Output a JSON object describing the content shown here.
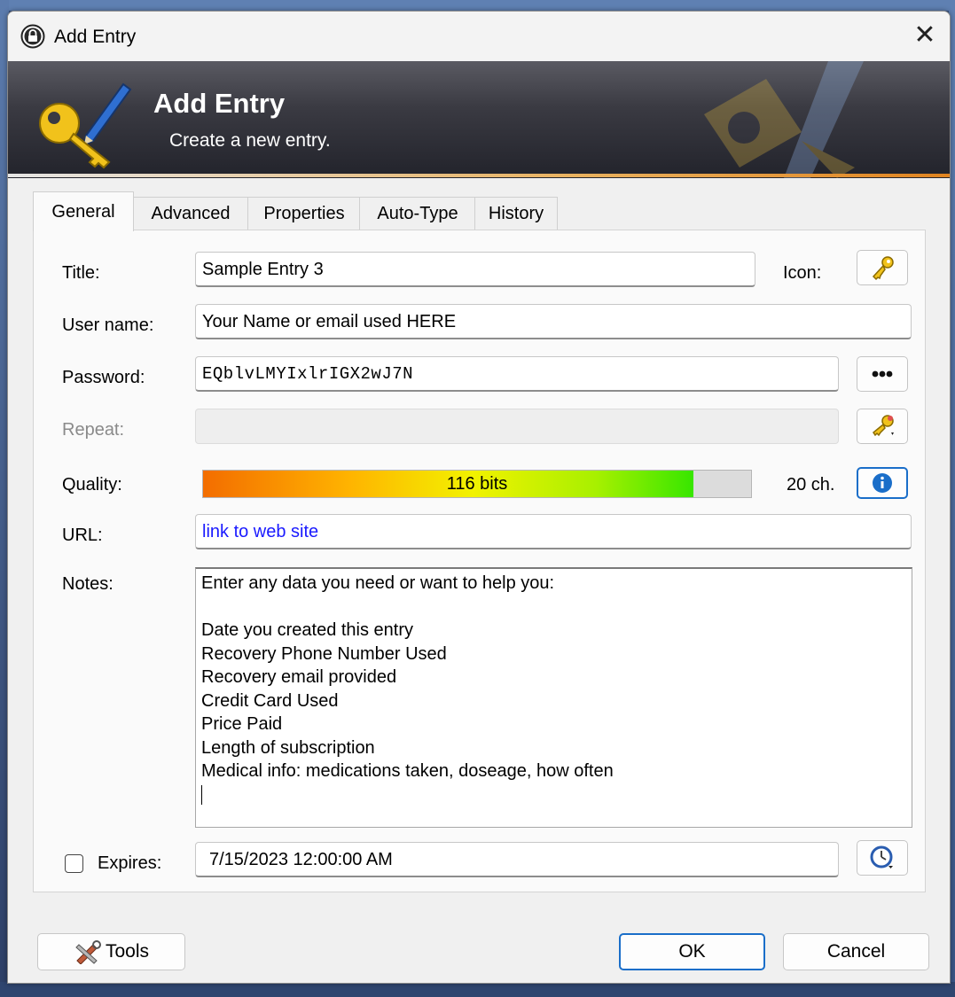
{
  "window": {
    "title": "Add Entry",
    "close_glyph": "✕"
  },
  "banner": {
    "title": "Add Entry",
    "subtitle": "Create a new entry."
  },
  "tabs": [
    {
      "label": "General",
      "active": true
    },
    {
      "label": "Advanced"
    },
    {
      "label": "Properties"
    },
    {
      "label": "Auto-Type"
    },
    {
      "label": "History"
    }
  ],
  "general": {
    "title_label": "Title:",
    "title_value": "Sample Entry 3",
    "icon_label": "Icon:",
    "username_label": "User name:",
    "username_value": "Your Name or email used HERE",
    "password_label": "Password:",
    "password_value": "EQblvLMYIxlrIGX2wJ7N",
    "repeat_label": "Repeat:",
    "quality_label": "Quality:",
    "quality_text": "116 bits",
    "quality_fraction": 0.895,
    "length_text": "20 ch.",
    "url_label": "URL:",
    "url_value": "link to web site",
    "notes_label": "Notes:",
    "notes_lines": [
      "Enter any data you need or want to help you:",
      "",
      "Date you created this entry",
      "Recovery Phone Number Used",
      "Recovery email provided",
      "Credit Card Used",
      "Price Paid",
      "Length of subscription",
      "Medical info: medications taken, doseage, how often"
    ],
    "expires_label": "Expires:",
    "expires_checked": false,
    "expires_value": "7/15/2023 12:00:00 AM"
  },
  "footer": {
    "tools_label": "Tools",
    "ok_label": "OK",
    "cancel_label": "Cancel"
  },
  "icons": {
    "app": "lock-icon",
    "banner": "key-pencil-icon",
    "entry_icon": "key-icon",
    "password_toggle": "dots-icon",
    "generator": "key-generator-icon",
    "info": "info-icon",
    "calendar": "calendar-icon",
    "expiry": "clock-icon",
    "tools": "tools-icon"
  },
  "colors": {
    "accent": "#1a6ec9",
    "link": "#1a1aff",
    "banner_dark": "#22232b"
  }
}
